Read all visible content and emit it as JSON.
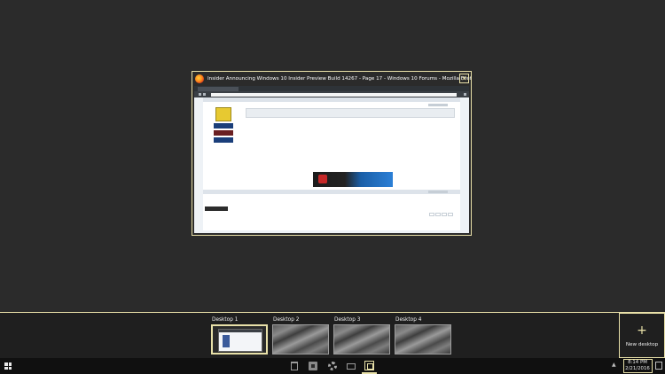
{
  "window": {
    "title": "Insider Announcing Windows 10 Insider Preview Build 14267 - Page 17 - Windows 10 Forums - Mozilla Firefox",
    "close_label": "✕"
  },
  "desktops": [
    {
      "label": "Desktop 1",
      "active": true
    },
    {
      "label": "Desktop 2",
      "active": false
    },
    {
      "label": "Desktop 3",
      "active": false
    },
    {
      "label": "Desktop 4",
      "active": false
    }
  ],
  "new_desktop": {
    "plus": "+",
    "label": "New desktop"
  },
  "taskbar": {
    "time": "8:14 PM",
    "date": "2/21/2016"
  },
  "colors": {
    "accent": "#e8e0a8",
    "background": "#2b2b2b"
  }
}
